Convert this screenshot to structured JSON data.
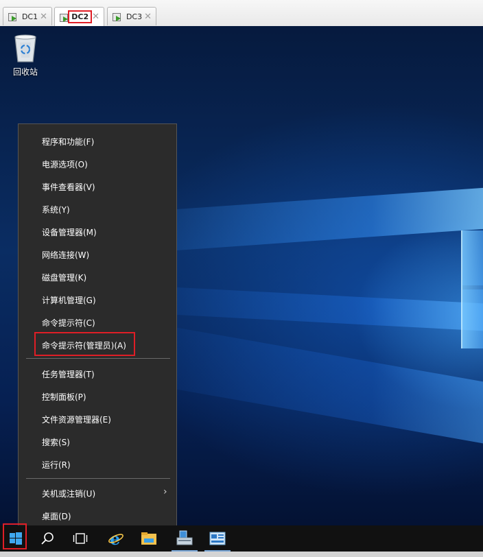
{
  "tabs": [
    {
      "label": "DC1",
      "active": false
    },
    {
      "label": "DC2",
      "active": true
    },
    {
      "label": "DC3",
      "active": false
    }
  ],
  "desktop": {
    "recycle_bin_label": "回收站"
  },
  "context_menu": {
    "items": [
      "程序和功能(F)",
      "电源选项(O)",
      "事件查看器(V)",
      "系统(Y)",
      "设备管理器(M)",
      "网络连接(W)",
      "磁盘管理(K)",
      "计算机管理(G)",
      "命令提示符(C)",
      "命令提示符(管理员)(A)",
      "任务管理器(T)",
      "控制面板(P)",
      "文件资源管理器(E)",
      "搜索(S)",
      "运行(R)",
      "关机或注销(U)",
      "桌面(D)"
    ],
    "highlighted_item": "命令提示符(管理员)(A)"
  },
  "taskbar": {
    "icons": [
      "windows-start-icon",
      "search-icon",
      "task-view-icon",
      "internet-explorer-icon",
      "file-explorer-icon",
      "server-manager-icon",
      "powershell-icon"
    ]
  },
  "colors": {
    "highlight_red": "#e01e26",
    "menu_bg": "#2b2b2b",
    "taskbar_bg": "#111111"
  }
}
